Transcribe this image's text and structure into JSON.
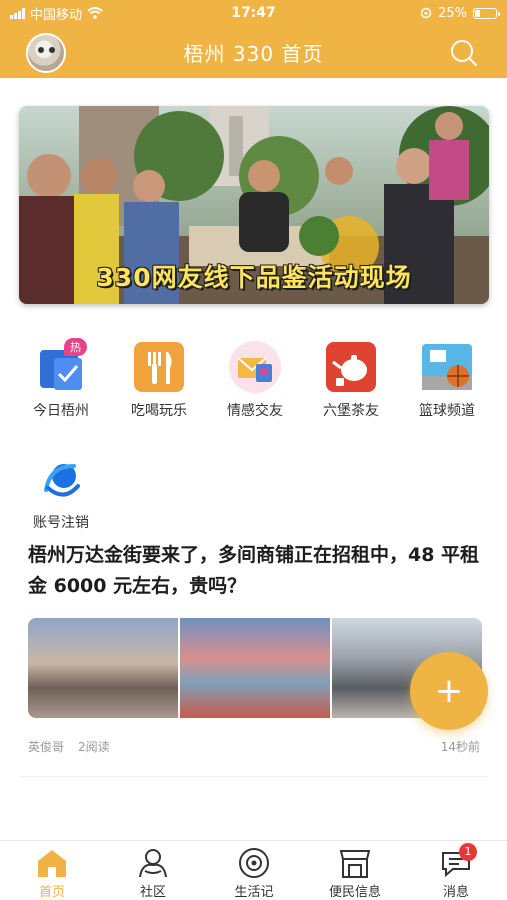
{
  "status_bar": {
    "carrier": "中国移动",
    "time": "17:47",
    "battery_percent": "25%",
    "battery_level": 0.25
  },
  "header": {
    "title": "梧州 330 首页",
    "avatar_icon": "cat-avatar",
    "search_icon": "search-icon",
    "color": "#efb443"
  },
  "banner": {
    "caption": "330网友线下品鉴活动现场"
  },
  "menu": {
    "items": [
      {
        "label": "今日梧州",
        "icon": "news-icon",
        "badge": "热"
      },
      {
        "label": "吃喝玩乐",
        "icon": "fork-knife-icon"
      },
      {
        "label": "情感交友",
        "icon": "love-letter-icon"
      },
      {
        "label": "六堡茶友",
        "icon": "teapot-icon"
      },
      {
        "label": "篮球频道",
        "icon": "basketball-icon"
      },
      {
        "label": "账号注销",
        "icon": "account-cancel-icon"
      }
    ]
  },
  "article": {
    "title": "梧州万达金街要来了，多间商铺正在招租中，48 平租金 6000 元左右，贵吗？",
    "author": "英俊哥",
    "reads": "2阅读",
    "time": "14秒前"
  },
  "fab": {
    "label": "+"
  },
  "tabbar": {
    "items": [
      {
        "label": "首页",
        "icon": "home-icon",
        "active": true
      },
      {
        "label": "社区",
        "icon": "community-icon"
      },
      {
        "label": "生活记",
        "icon": "camera-icon"
      },
      {
        "label": "便民信息",
        "icon": "shop-icon"
      },
      {
        "label": "消息",
        "icon": "message-icon",
        "badge": "1"
      }
    ]
  },
  "colors": {
    "accent": "#efb443",
    "badge_red": "#e53935",
    "hot_pink": "#e8428a"
  }
}
